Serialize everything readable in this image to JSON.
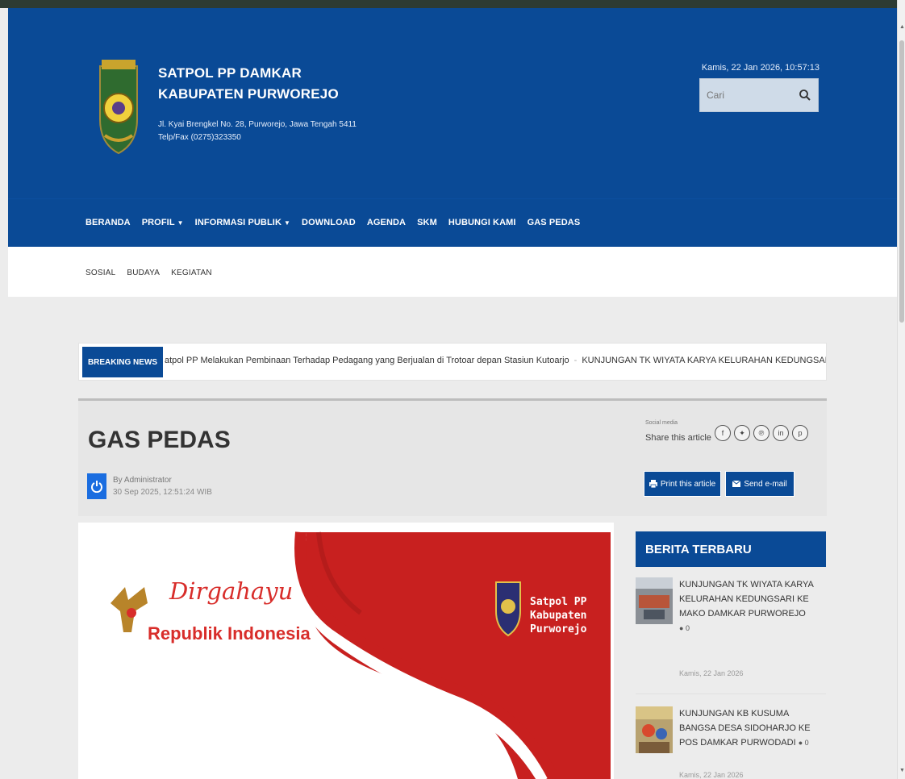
{
  "site": {
    "title_line1": "SATPOL PP DAMKAR",
    "title_line2": "KABUPATEN PURWOREJO",
    "address": "Jl. Kyai Brengkel No. 28, Purworejo, Jawa Tengah 5411",
    "phone": "Telp/Fax (0275)323350"
  },
  "header": {
    "datetime": "Kamis, 22 Jan 2026, 10:57:13",
    "search_placeholder": "Cari"
  },
  "nav": {
    "items": [
      {
        "label": "BERANDA"
      },
      {
        "label": "PROFIL"
      },
      {
        "label": "INFORMASI PUBLIK"
      },
      {
        "label": "DOWNLOAD"
      },
      {
        "label": "AGENDA"
      },
      {
        "label": "SKM"
      },
      {
        "label": "HUBUNGI KAMI"
      },
      {
        "label": "GAS PEDAS"
      }
    ]
  },
  "subnav": {
    "items": [
      "SOSIAL",
      "BUDAYA",
      "KEGIATAN"
    ]
  },
  "breaking": {
    "label": "BREAKING NEWS",
    "item1": "atpol PP Melakukan Pembinaan Terhadap Pedagang yang Berjualan di Trotoar depan Stasiun Kutoarjo",
    "separator": "-",
    "item2": "KUNJUNGAN TK WIYATA KARYA KELURAHAN KEDUNGSARI"
  },
  "article": {
    "title": "GAS PEDAS",
    "author": "By Administrator",
    "date": "30 Sep 2025, 12:51:24 WIB",
    "share_label": "Social media",
    "share_text": "Share this article",
    "print_label": "Print this article",
    "email_label": "Send e-mail"
  },
  "banner": {
    "dirgahayu": "Dirgahayu",
    "republik": "Republik Indonesia",
    "brand_line1": "Satpol PP",
    "brand_line2": "Kabupaten",
    "brand_line3": "Purworejo"
  },
  "sidebar": {
    "heading": "BERITA TERBARU",
    "news": [
      {
        "title": "KUNJUNGAN TK WIYATA KARYA KELURAHAN KEDUNGSARI KE MAKO DAMKAR PURWOREJO",
        "count": "0",
        "date": "Kamis, 22 Jan 2026"
      },
      {
        "title": "KUNJUNGAN KB KUSUMA BANGSA DESA SIDOHARJO KE POS DAMKAR PURWODADI",
        "count": "0",
        "date": "Kamis, 22 Jan 2026"
      }
    ]
  },
  "colors": {
    "brand_blue": "#0a4a96",
    "banner_red": "#c8201f"
  },
  "icons": {
    "search": "search-icon",
    "share": [
      "facebook-icon",
      "twitter-icon",
      "pinterest-icon",
      "linkedin-icon",
      "pinterest-alt-icon"
    ],
    "print": "print-icon",
    "email": "email-icon",
    "author": "power-icon"
  }
}
